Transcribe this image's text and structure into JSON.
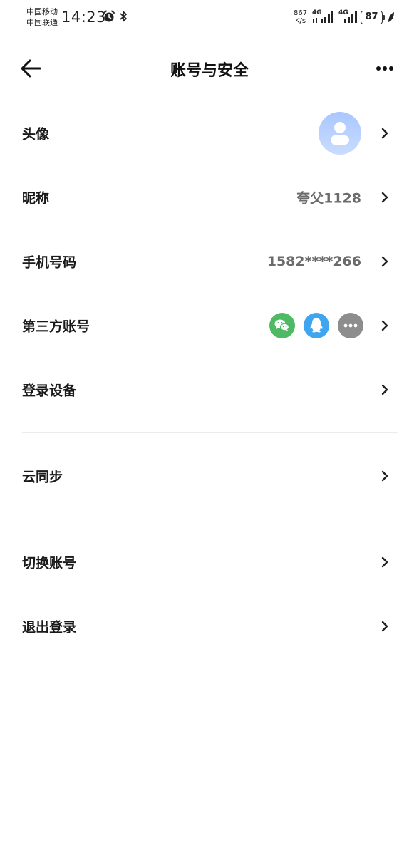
{
  "status_bar": {
    "carrier1": "中国移动",
    "carrier2": "中国联通",
    "time": "14:23",
    "net_speed_value": "867",
    "net_speed_unit": "K/s",
    "sig1_label": "4G",
    "sig2_label": "4G",
    "battery": "87",
    "icons": [
      "alarm-icon",
      "bluetooth-icon",
      "signal-icon",
      "signal-icon",
      "battery-icon",
      "leaf-icon"
    ]
  },
  "header": {
    "title": "账号与安全",
    "back_icon": "arrow-left-icon",
    "more_icon": "more-horizontal-icon"
  },
  "rows": [
    {
      "label": "头像",
      "value": "",
      "right": "avatar"
    },
    {
      "label": "昵称",
      "value": "夸父1128"
    },
    {
      "label": "手机号码",
      "value": "1582****266"
    },
    {
      "label": "第三方账号",
      "value": "",
      "icons": [
        "wechat-icon",
        "qq-icon",
        "more-icon"
      ]
    },
    {
      "label": "登录设备",
      "value": ""
    },
    {
      "label": "云同步",
      "value": ""
    },
    {
      "label": "切换账号",
      "value": ""
    },
    {
      "label": "退出登录",
      "value": ""
    }
  ],
  "colors": {
    "wechat": "#4fba64",
    "qq": "#3ea5ee",
    "more": "#8d8d8d",
    "avatar": "#a9c7ff",
    "value_text": "#6b6b6b"
  }
}
